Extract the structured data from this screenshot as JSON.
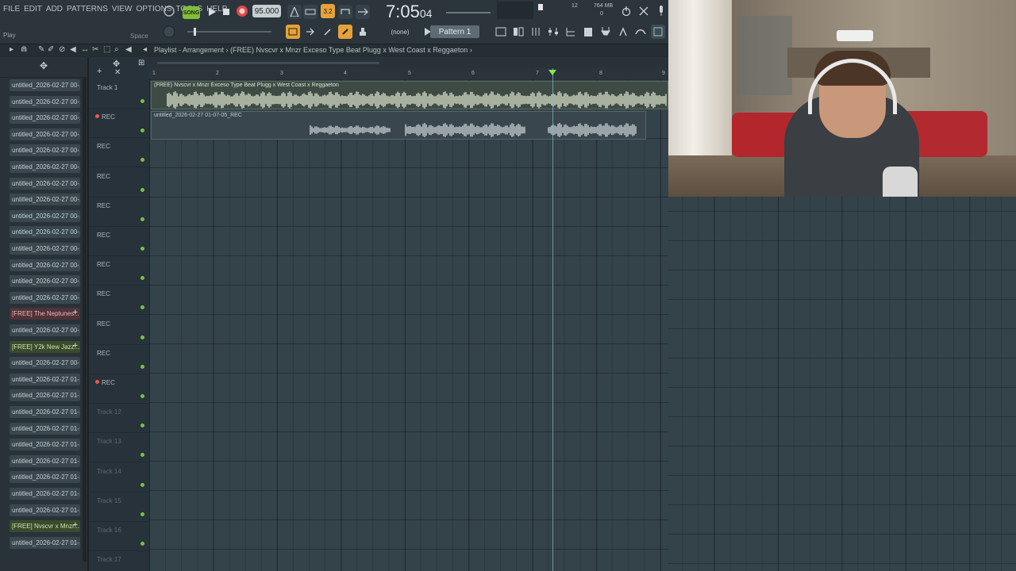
{
  "menu": [
    "FILE",
    "EDIT",
    "ADD",
    "PATTERNS",
    "VIEW",
    "OPTIONS",
    "TOOLS",
    "HELP"
  ],
  "toolbar": {
    "mode": "SONG",
    "tempo": "95.000",
    "clock": "7:05",
    "clock_frac": "04",
    "cpu": "12",
    "memory": "764 MB",
    "memory_sub": "0",
    "hint_action": "Play",
    "hint_key": "Space",
    "snap": "(none)",
    "pattern": "Pattern 1"
  },
  "playlist": {
    "breadcrumb": "Playlist - Arrangement › (FREE) Nvscvr x Mnzr Exceso Type Beat  Plugg x West Coast x Reggaeton ›",
    "ruler": [
      "1",
      "2",
      "3",
      "4",
      "5",
      "6",
      "7",
      "8",
      "9"
    ],
    "clip1_title": "(FREE) Nvscvr x Mnzr Exceso Type Beat  Plugg x West Coast x Reggaeton",
    "clip2_title": "untitled_2026-02-27 01-07-05_REC"
  },
  "tracks": [
    {
      "label": "Track 1",
      "dim": false,
      "rec_dot": false
    },
    {
      "label": "REC",
      "dim": false,
      "rec_dot": true
    },
    {
      "label": "REC",
      "dim": false,
      "rec_dot": false
    },
    {
      "label": "REC",
      "dim": false,
      "rec_dot": false
    },
    {
      "label": "REC",
      "dim": false,
      "rec_dot": false
    },
    {
      "label": "REC",
      "dim": false,
      "rec_dot": false
    },
    {
      "label": "REC",
      "dim": false,
      "rec_dot": false
    },
    {
      "label": "REC",
      "dim": false,
      "rec_dot": false
    },
    {
      "label": "REC",
      "dim": false,
      "rec_dot": false
    },
    {
      "label": "REC",
      "dim": false,
      "rec_dot": false
    },
    {
      "label": "REC",
      "dim": false,
      "rec_dot": true
    },
    {
      "label": "Track 12",
      "dim": true,
      "rec_dot": false
    },
    {
      "label": "Track 13",
      "dim": true,
      "rec_dot": false
    },
    {
      "label": "Track 14",
      "dim": true,
      "rec_dot": false
    },
    {
      "label": "Track 15",
      "dim": true,
      "rec_dot": false
    },
    {
      "label": "Track 16",
      "dim": true,
      "rec_dot": false
    },
    {
      "label": "Track 17",
      "dim": true,
      "rec_dot": false
    }
  ],
  "browser_items": [
    {
      "label": "untitled_2026-02-27 00-...",
      "style": "normal"
    },
    {
      "label": "untitled_2026-02-27 00-...",
      "style": "normal"
    },
    {
      "label": "untitled_2026-02-27 00-...",
      "style": "normal"
    },
    {
      "label": "untitled_2026-02-27 00-...",
      "style": "normal"
    },
    {
      "label": "untitled_2026-02-27 00-...",
      "style": "normal"
    },
    {
      "label": "untitled_2026-02-27 00-...",
      "style": "normal"
    },
    {
      "label": "untitled_2026-02-27 00-...",
      "style": "normal"
    },
    {
      "label": "untitled_2026-02-27 00-...",
      "style": "normal"
    },
    {
      "label": "untitled_2026-02-27 00-...",
      "style": "normal"
    },
    {
      "label": "untitled_2026-02-27 00-...",
      "style": "normal"
    },
    {
      "label": "untitled_2026-02-27 00-...",
      "style": "normal"
    },
    {
      "label": "untitled_2026-02-27 00-...",
      "style": "normal"
    },
    {
      "label": "untitled_2026-02-27 00-...",
      "style": "normal"
    },
    {
      "label": "untitled_2026-02-27 00-...",
      "style": "normal"
    },
    {
      "label": "[FREE] The Neptunes...",
      "style": "free-red"
    },
    {
      "label": "untitled_2026-02-27 00-...",
      "style": "normal"
    },
    {
      "label": "[FREE] Y2k  New Jazz...",
      "style": "free-green"
    },
    {
      "label": "untitled_2026-02-27 00-...",
      "style": "normal"
    },
    {
      "label": "untitled_2026-02-27 01-...",
      "style": "normal"
    },
    {
      "label": "untitled_2026-02-27 01-...",
      "style": "normal"
    },
    {
      "label": "untitled_2026-02-27 01-...",
      "style": "normal"
    },
    {
      "label": "untitled_2026-02-27 01-...",
      "style": "normal"
    },
    {
      "label": "untitled_2026-02-27 01-...",
      "style": "normal"
    },
    {
      "label": "untitled_2026-02-27 01-...",
      "style": "normal"
    },
    {
      "label": "untitled_2026-02-27 01-...",
      "style": "normal"
    },
    {
      "label": "untitled_2026-02-27 01-...",
      "style": "normal"
    },
    {
      "label": "untitled_2026-02-27 01-...",
      "style": "normal"
    },
    {
      "label": "[FREE] Nvscvr x Mnzr...",
      "style": "free-green"
    },
    {
      "label": "untitled_2026-02-27 01-...",
      "style": "normal"
    }
  ],
  "colors": {
    "accent_green": "#7fbf3a",
    "record_red": "#e04848",
    "grid_bg": "#34424a"
  }
}
